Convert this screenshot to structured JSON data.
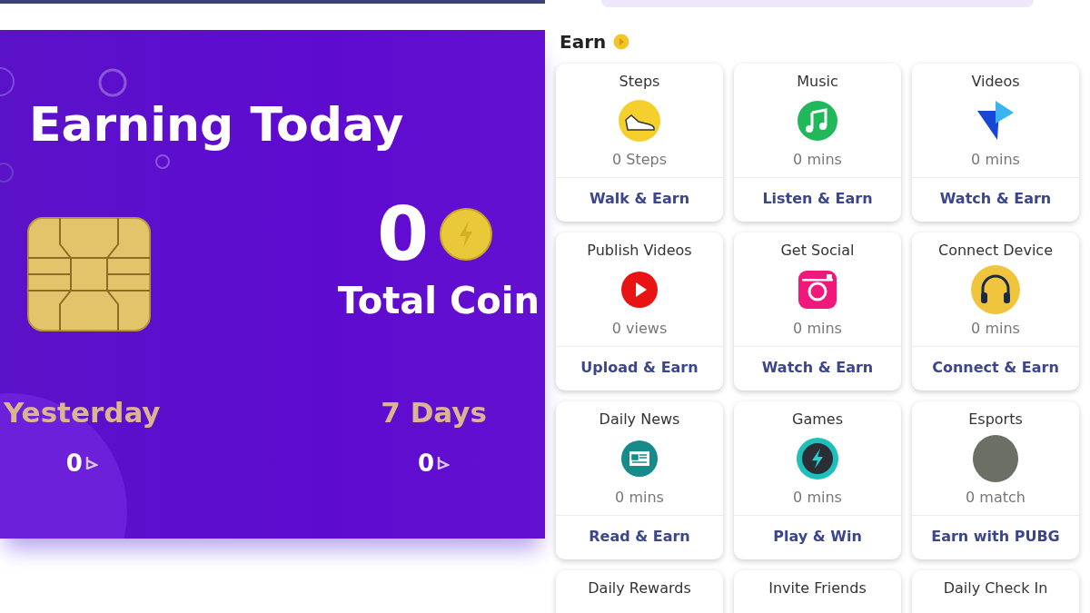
{
  "earning_card": {
    "title": "Earning Today",
    "total_value": "0",
    "total_label": "Total Coin",
    "stats": [
      {
        "label": "Yesterday",
        "value": "0"
      },
      {
        "label": "7 Days",
        "value": "0"
      }
    ]
  },
  "earn": {
    "heading": "Earn",
    "cards": [
      {
        "title": "Steps",
        "kind": "shoe",
        "value": "0 Steps",
        "action": "Walk & Earn"
      },
      {
        "title": "Music",
        "kind": "music",
        "value": "0 mins",
        "action": "Listen & Earn"
      },
      {
        "title": "Videos",
        "kind": "video",
        "value": "0 mins",
        "action": "Watch & Earn"
      },
      {
        "title": "Publish Videos",
        "kind": "play",
        "value": "0 views",
        "action": "Upload & Earn"
      },
      {
        "title": "Get Social",
        "kind": "camera",
        "value": "0 mins",
        "action": "Watch & Earn"
      },
      {
        "title": "Connect Device",
        "kind": "headphones",
        "value": "0 mins",
        "action": "Connect & Earn"
      },
      {
        "title": "Daily News",
        "kind": "news",
        "value": "0 mins",
        "action": "Read & Earn"
      },
      {
        "title": "Games",
        "kind": "bolt",
        "value": "0 mins",
        "action": "Play & Win"
      },
      {
        "title": "Esports",
        "kind": "poster",
        "value": "0 match",
        "action": "Earn with PUBG"
      }
    ],
    "partial_cards": [
      {
        "title": "Daily Rewards"
      },
      {
        "title": "Invite Friends"
      },
      {
        "title": "Daily Check In"
      }
    ]
  }
}
